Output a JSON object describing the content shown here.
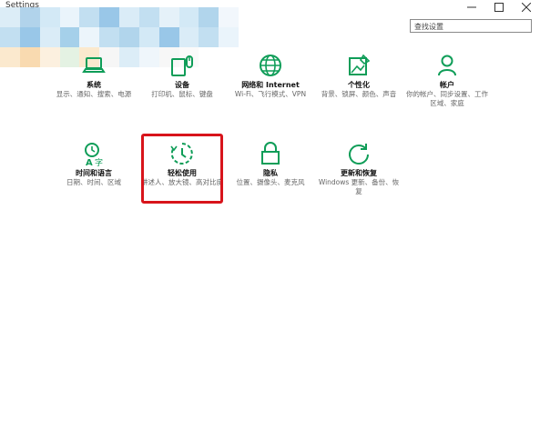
{
  "window": {
    "title": "Settings",
    "min_icon": "minimize-icon",
    "max_icon": "maximize-icon",
    "close_icon": "close-icon"
  },
  "search": {
    "value": "查找设置"
  },
  "accent_color": "#0f9d58",
  "highlight_color": "#d8141b",
  "tiles": [
    {
      "id": "system",
      "label": "系统",
      "desc": "显示、通知、搜索、电源",
      "icon": "laptop-icon"
    },
    {
      "id": "devices",
      "label": "设备",
      "desc": "打印机、鼠标、键盘",
      "icon": "devices-icon"
    },
    {
      "id": "network",
      "label": "网络和 Internet",
      "desc": "Wi-Fi、飞行模式、VPN",
      "icon": "globe-icon"
    },
    {
      "id": "personalization",
      "label": "个性化",
      "desc": "背景、锁屏、颜色、声音",
      "icon": "personalize-icon"
    },
    {
      "id": "accounts",
      "label": "帐户",
      "desc": "你的帐户、同步设置、工作区域、家庭",
      "icon": "account-icon"
    },
    {
      "id": "time",
      "label": "时间和语言",
      "desc": "日期、时间、区域",
      "icon": "time-language-icon"
    },
    {
      "id": "ease",
      "label": "轻松使用",
      "desc": "讲述人、放大镜、高对比度",
      "icon": "ease-of-access-icon"
    },
    {
      "id": "privacy",
      "label": "隐私",
      "desc": "位置、摄像头、麦克风",
      "icon": "lock-icon"
    },
    {
      "id": "update",
      "label": "更新和恢复",
      "desc": "Windows 更新、备份、恢复",
      "icon": "refresh-icon"
    }
  ]
}
